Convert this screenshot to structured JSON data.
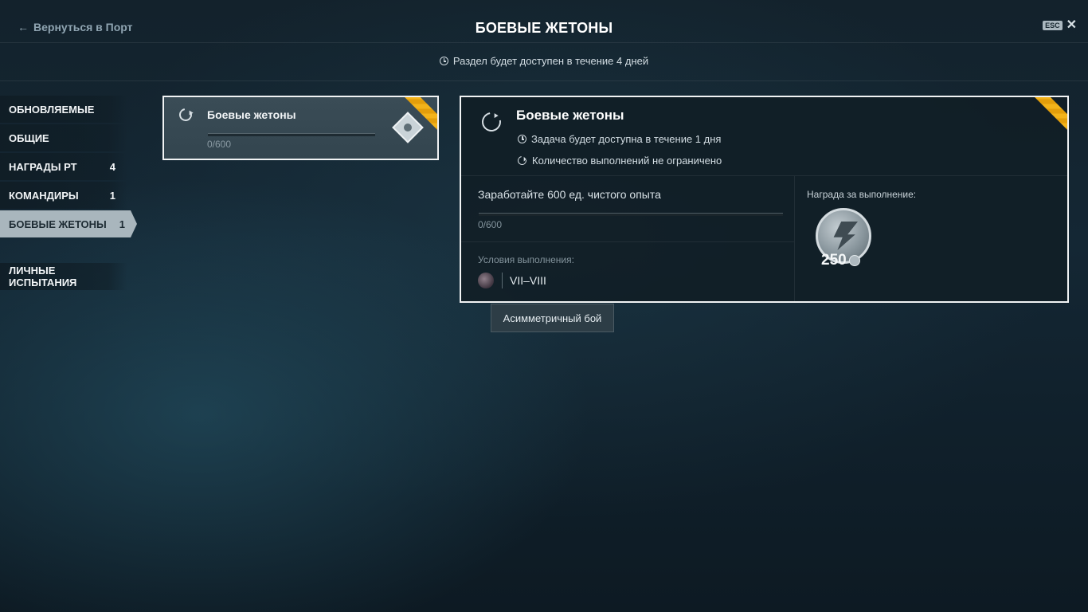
{
  "header": {
    "back_label": "Вернуться в Порт",
    "title": "БОЕВЫЕ ЖЕТОНЫ",
    "esc_label": "ESC",
    "close_symbol": "✕"
  },
  "availability": "Раздел будет доступен в течение 4 дней",
  "sidebar": {
    "items": [
      {
        "label": "ОБНОВЛЯЕМЫЕ",
        "count": ""
      },
      {
        "label": "ОБЩИЕ",
        "count": ""
      },
      {
        "label": "НАГРАДЫ РТ",
        "count": "4"
      },
      {
        "label": "КОМАНДИРЫ",
        "count": "1"
      },
      {
        "label": "БОЕВЫЕ ЖЕТОНЫ",
        "count": "1",
        "active": true
      },
      {
        "label": "ЛИЧНЫЕ ИСПЫТАНИЯ",
        "count": ""
      }
    ]
  },
  "card": {
    "title": "Боевые жетоны",
    "progress": "0/600",
    "progress_fraction": 0
  },
  "detail": {
    "title": "Боевые жетоны",
    "availability": "Задача будет доступна в течение 1 дня",
    "repeat": "Количество выполнений не ограничено",
    "task": "Заработайте 600 ед. чистого опыта",
    "progress": "0/600",
    "progress_fraction": 0,
    "conditions_label": "Условия выполнения:",
    "tiers": "VII–VIII",
    "reward_label": "Награда за выполнение:",
    "reward_amount": "250"
  },
  "tooltip": "Асимметричный бой",
  "colors": {
    "ribbon": "#f3b31a",
    "active_tab": "#a9b6bd",
    "border": "#f1f3f4"
  },
  "icons": [
    "back-arrow-icon",
    "clock-icon",
    "refresh-icon",
    "diamond-icon",
    "battle-type-icon",
    "token-coin-icon",
    "close-icon"
  ]
}
